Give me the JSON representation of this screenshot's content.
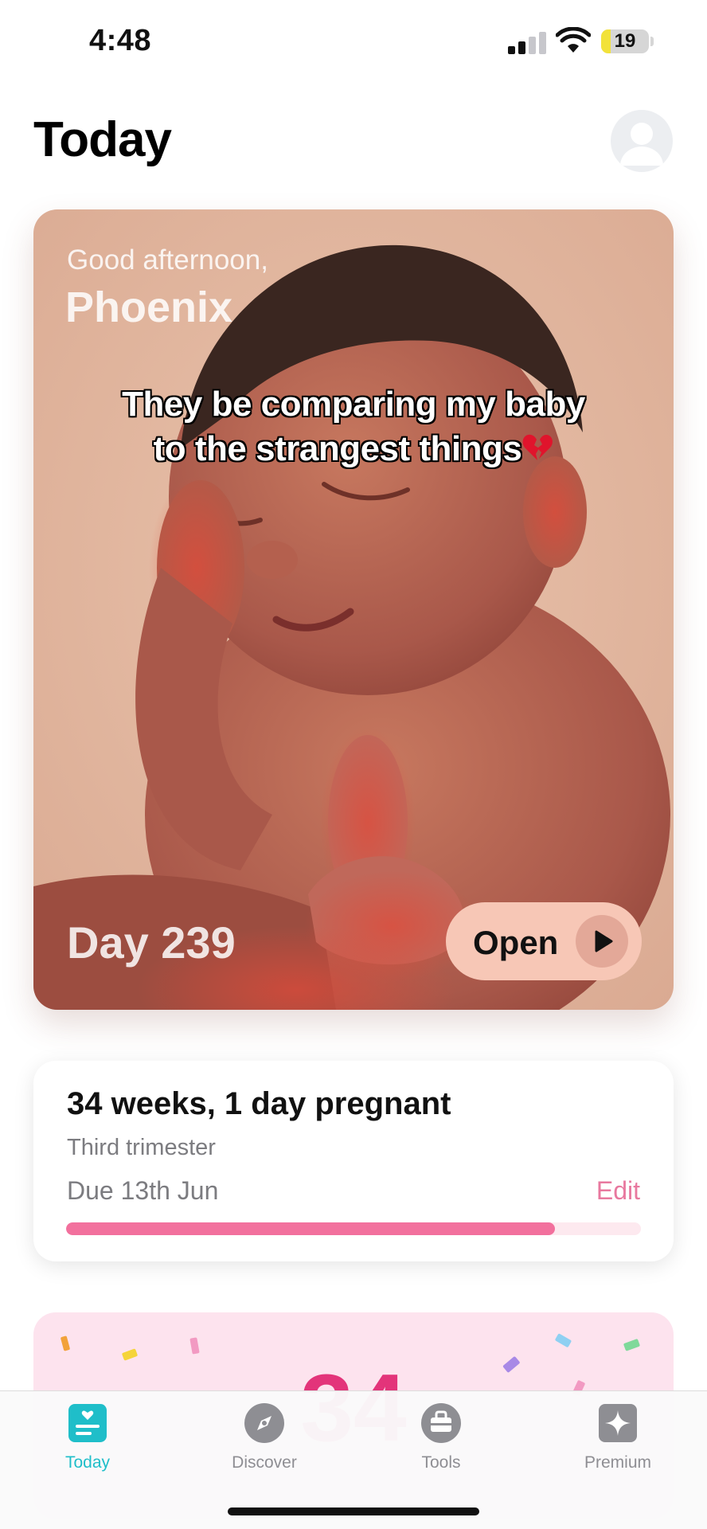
{
  "status_bar": {
    "time": "4:48",
    "battery_level": "19",
    "battery_color": "#f2e23a"
  },
  "header": {
    "title": "Today",
    "avatar_icon": "user-avatar-icon"
  },
  "hero": {
    "greeting": "Good afternoon,",
    "user_name": "Phoenix",
    "caption_line1": "They be comparing my baby",
    "caption_line2": "to the strangest things",
    "caption_emoji": "broken-heart-icon",
    "day_label": "Day 239",
    "open_label": "Open",
    "play_icon": "play-icon"
  },
  "pregnancy": {
    "title": "34 weeks, 1 day pregnant",
    "trimester": "Third trimester",
    "due": "Due 13th Jun",
    "edit_label": "Edit",
    "progress_fraction": 0.85,
    "accent_color": "#f2709d"
  },
  "confetti_card": {
    "count_text": "34"
  },
  "tabs": [
    {
      "label": "Today",
      "icon": "today-icon",
      "active": true,
      "color": "#1fbec9"
    },
    {
      "label": "Discover",
      "icon": "compass-icon",
      "active": false
    },
    {
      "label": "Tools",
      "icon": "toolbox-icon",
      "active": false
    },
    {
      "label": "Premium",
      "icon": "sparkle-icon",
      "active": false
    }
  ]
}
